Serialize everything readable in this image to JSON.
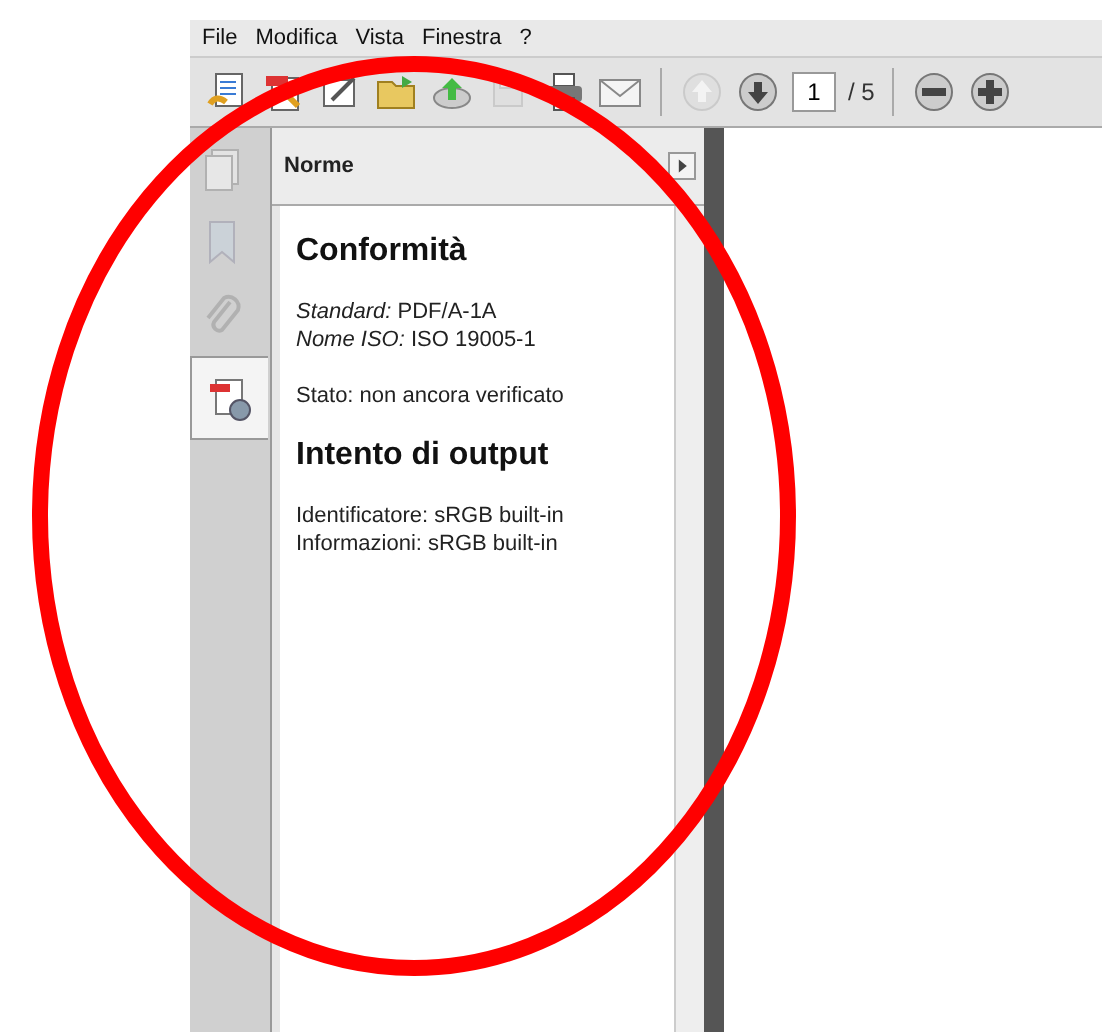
{
  "menu": [
    "File",
    "Modifica",
    "Vista",
    "Finestra",
    "?"
  ],
  "toolbar": {
    "page_field": {
      "value": "1"
    },
    "page_total": "/ 5"
  },
  "nav_tabs": [
    {
      "kind": "pages",
      "selected": false
    },
    {
      "kind": "bookmarks",
      "selected": false
    },
    {
      "kind": "attachments",
      "selected": false
    },
    {
      "kind": "standards",
      "selected": true
    }
  ],
  "panel": {
    "title": "Norme",
    "sections": [
      {
        "heading": "Conformità",
        "groups": [
          [
            "*Standard:* PDF/A-1A",
            "*Nome ISO:* ISO 19005-1"
          ],
          [
            "Stato: non ancora verificato"
          ]
        ]
      },
      {
        "heading": "Intento di output",
        "groups": [
          [
            "Identificatore: sRGB built-in",
            "Informazioni: sRGB built-in"
          ]
        ]
      }
    ]
  }
}
